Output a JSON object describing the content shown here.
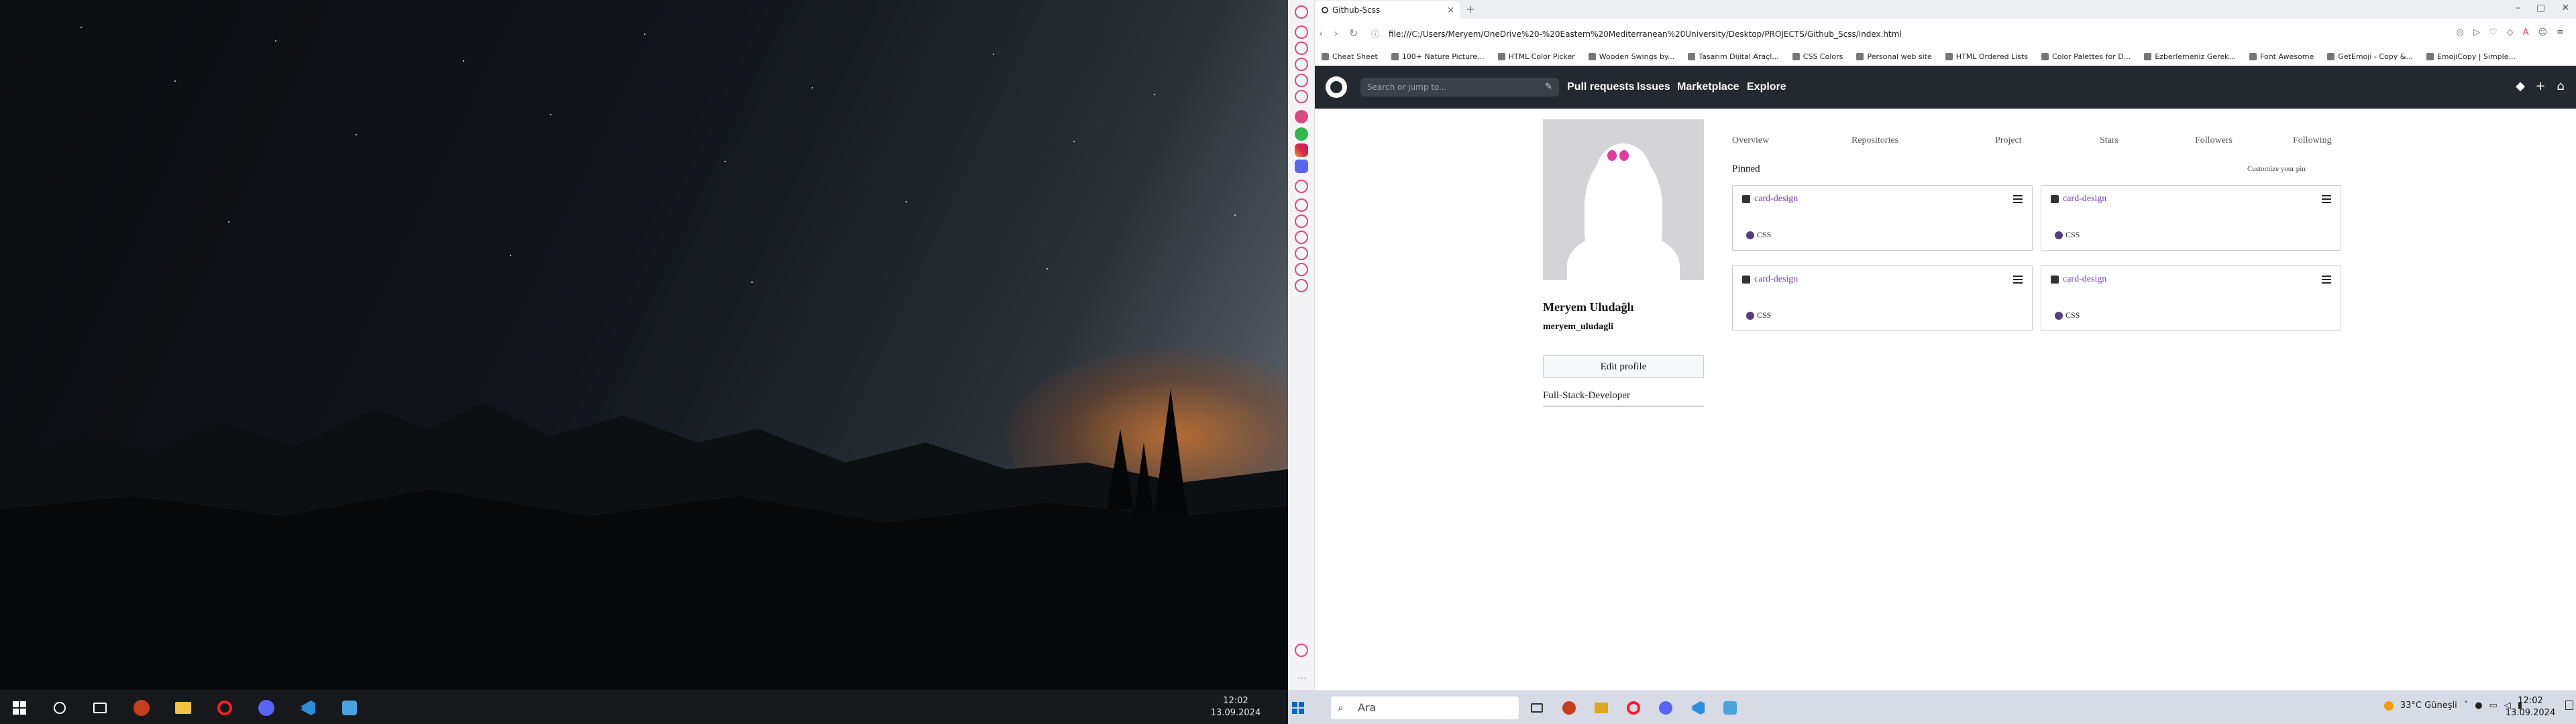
{
  "monitor_left": {
    "taskbar": {
      "clock_time": "12:02",
      "clock_date": "13.09.2024",
      "apps": [
        "windows-logo-icon",
        "search-icon",
        "task-view-icon",
        "powerpoint-icon",
        "file-explorer-icon",
        "opera-icon",
        "discord-icon",
        "vscode-icon",
        "azure-data-studio-icon"
      ]
    }
  },
  "browser": {
    "tab_title": "Github-Scss",
    "tab_close": "×",
    "new_tab": "+",
    "url": "file:///C:/Users/Meryem/OneDrive%20-%20Eastern%20Mediterranean%20University/Desktop/PROJECTS/Github_Scss/index.html",
    "bookmarks": [
      "Cheat Sheet",
      "100+ Nature Picture...",
      "HTML Color Picker",
      "Wooden Swings by...",
      "Tasarım Dijital Araçl...",
      "CSS Colors",
      "Personal web site",
      "HTML Ordered Lists",
      "Color Palettes for D...",
      "Ezberlemeniz Gerek...",
      "Font Awesome",
      "GetEmoji - Copy &...",
      "EmojiCopy | Simple..."
    ]
  },
  "github_nav": {
    "search_placeholder": "Search or jump to...",
    "links": [
      "Pull requests",
      "Issues",
      "Marketplace",
      "Explore"
    ]
  },
  "profile": {
    "name": "Meryem Uludağlı",
    "username": "meryem_uludagli",
    "edit_label": "Edit profile",
    "bio": "Full-Stack-Developer"
  },
  "tabs": [
    "Overview",
    "Repositories",
    "Project",
    "Stars",
    "Followers",
    "Following"
  ],
  "pinned": {
    "heading": "Pinned",
    "customize": "Customize your pin",
    "cards": [
      {
        "name": "card-design",
        "lang": "CSS"
      },
      {
        "name": "card-design",
        "lang": "CSS"
      },
      {
        "name": "card-design",
        "lang": "CSS"
      },
      {
        "name": "card-design",
        "lang": "CSS"
      }
    ],
    "lang_color": "#563d7c"
  },
  "taskbar_right": {
    "search_label": "Ara",
    "weather": "33°C  Güneşli",
    "clock_time": "12:02",
    "clock_date": "13.09.2024"
  },
  "colors": {
    "accent": "#d94a83",
    "github_header": "#24292f",
    "repo_link": "#6f42c1"
  }
}
